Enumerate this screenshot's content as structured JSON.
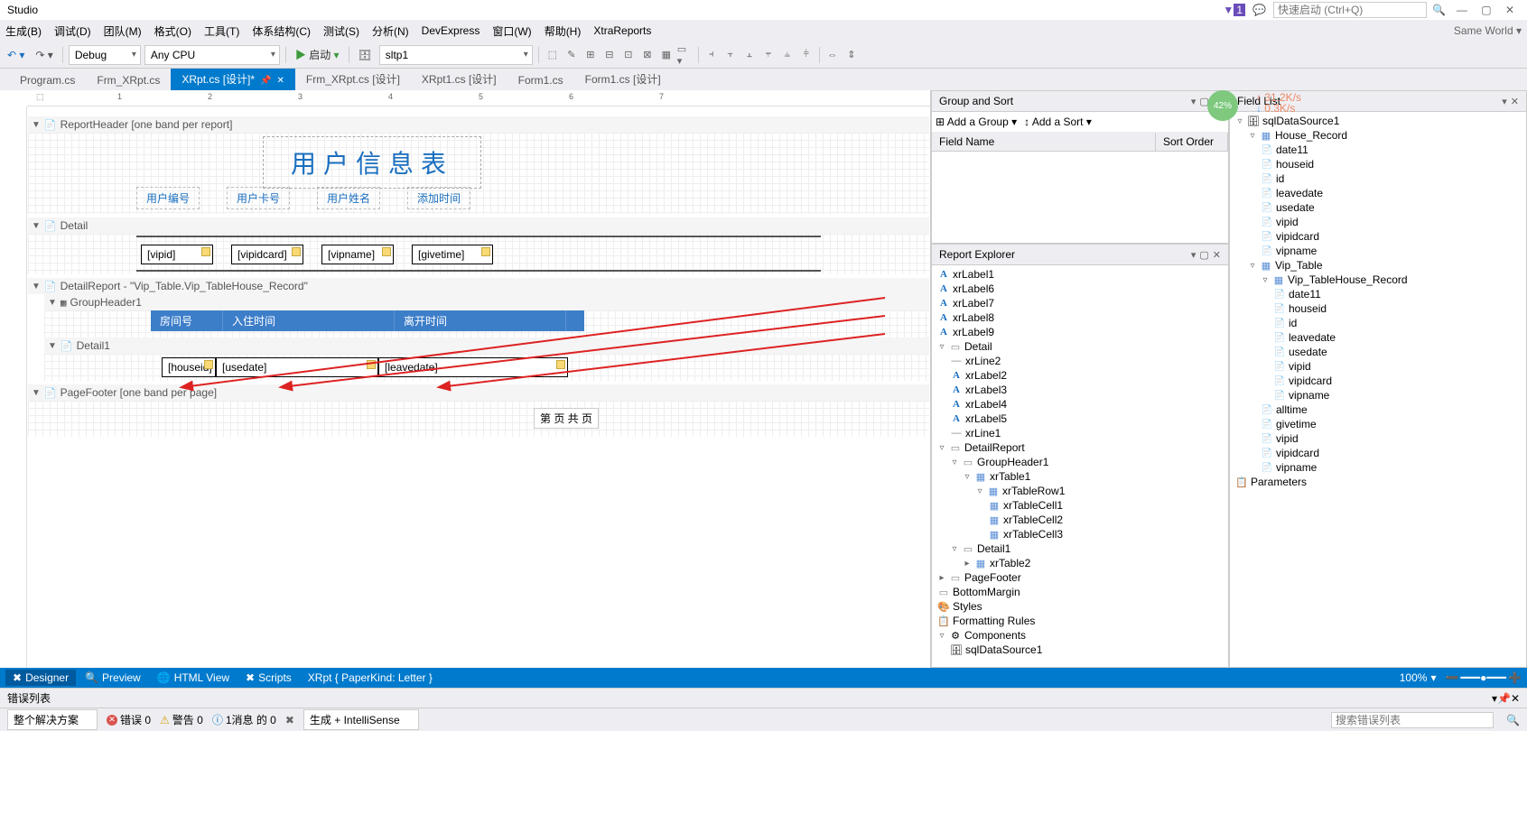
{
  "titleBar": {
    "appName": "Studio",
    "quickLaunchPlaceholder": "快速启动 (Ctrl+Q)"
  },
  "menu": {
    "items": [
      "生成(B)",
      "调试(D)",
      "团队(M)",
      "格式(O)",
      "工具(T)",
      "体系结构(C)",
      "测试(S)",
      "分析(N)",
      "DevExpress",
      "窗口(W)",
      "帮助(H)",
      "XtraReports"
    ],
    "right": "Same World ▾"
  },
  "toolbar": {
    "config": "Debug",
    "platform": "Any CPU",
    "startLabel": "启动",
    "dataSource": "sltp1",
    "percentBadge": "42%",
    "netUp": "31.2K/s",
    "netDown": "0.3K/s"
  },
  "tabs": [
    {
      "label": "Program.cs",
      "active": false
    },
    {
      "label": "Frm_XRpt.cs",
      "active": false
    },
    {
      "label": "XRpt.cs [设计]*",
      "active": true,
      "close": true
    },
    {
      "label": "Frm_XRpt.cs [设计]",
      "active": false
    },
    {
      "label": "XRpt1.cs [设计]",
      "active": false
    },
    {
      "label": "Form1.cs",
      "active": false
    },
    {
      "label": "Form1.cs [设计]",
      "active": false
    }
  ],
  "rulerTicks": [
    "1",
    "2",
    "3",
    "4",
    "5",
    "6",
    "7"
  ],
  "bands": {
    "reportHeader": {
      "label": "ReportHeader [one band per report]",
      "title": "用户信息表",
      "cols": [
        "用户编号",
        "用户卡号",
        "用户姓名",
        "添加时间"
      ]
    },
    "detail": {
      "label": "Detail",
      "fields": [
        "[vipid]",
        "[vipidcard]",
        "[vipname]",
        "[givetime]"
      ]
    },
    "detailReport": {
      "label": "DetailReport - \"Vip_Table.Vip_TableHouse_Record\"",
      "groupHeader": {
        "label": "GroupHeader1",
        "cols": [
          "房间号",
          "入住时间",
          "离开时间"
        ]
      },
      "detail1": {
        "label": "Detail1",
        "fields": [
          "[houseid]",
          "[usedate]",
          "[leavedate]"
        ]
      }
    },
    "pageFooter": {
      "label": "PageFooter [one band per page]",
      "text": "第 页 共 页"
    }
  },
  "groupSort": {
    "title": "Group and Sort",
    "addGroup": "Add a Group",
    "addSort": "Add a Sort",
    "colField": "Field Name",
    "colSort": "Sort Order"
  },
  "reportExplorer": {
    "title": "Report Explorer",
    "labels": [
      "xrLabel1",
      "xrLabel6",
      "xrLabel7",
      "xrLabel8",
      "xrLabel9"
    ],
    "detailNode": "Detail",
    "detailItems": [
      "xrLine2",
      "xrLabel2",
      "xrLabel3",
      "xrLabel4",
      "xrLabel5",
      "xrLine1"
    ],
    "detailReport": "DetailReport",
    "groupHeader": "GroupHeader1",
    "xrTable1": "xrTable1",
    "xrTableRow1": "xrTableRow1",
    "cells": [
      "xrTableCell1",
      "xrTableCell2",
      "xrTableCell3"
    ],
    "detail1": "Detail1",
    "xrTable2": "xrTable2",
    "pageFooter": "PageFooter",
    "bottomMargin": "BottomMargin",
    "styles": "Styles",
    "formattingRules": "Formatting Rules",
    "components": "Components",
    "sqlDataSource": "sqlDataSource1"
  },
  "fieldList": {
    "title": "Field List",
    "root": "sqlDataSource1",
    "houseRecord": "House_Record",
    "houseFields": [
      "date11",
      "houseid",
      "id",
      "leavedate",
      "usedate",
      "vipid",
      "vipidcard",
      "vipname"
    ],
    "vipTable": "Vip_Table",
    "vipTableHouse": "Vip_TableHouse_Record",
    "vipHouseFields": [
      "date11",
      "houseid",
      "id",
      "leavedate",
      "usedate",
      "vipid",
      "vipidcard",
      "vipname"
    ],
    "vipFields": [
      "alltime",
      "givetime",
      "vipid",
      "vipidcard",
      "vipname"
    ],
    "parameters": "Parameters"
  },
  "bottomTabs": {
    "designer": "Designer",
    "preview": "Preview",
    "htmlView": "HTML View",
    "scripts": "Scripts",
    "paperKind": "XRpt { PaperKind: Letter }",
    "zoom": "100%"
  },
  "errorList": {
    "title": "错误列表",
    "solution": "整个解决方案",
    "errors": "错误 0",
    "warnings": "警告 0",
    "messages": "1消息 的 0",
    "buildIntelli": "生成 + IntelliSense",
    "searchPlaceholder": "搜索错误列表"
  }
}
